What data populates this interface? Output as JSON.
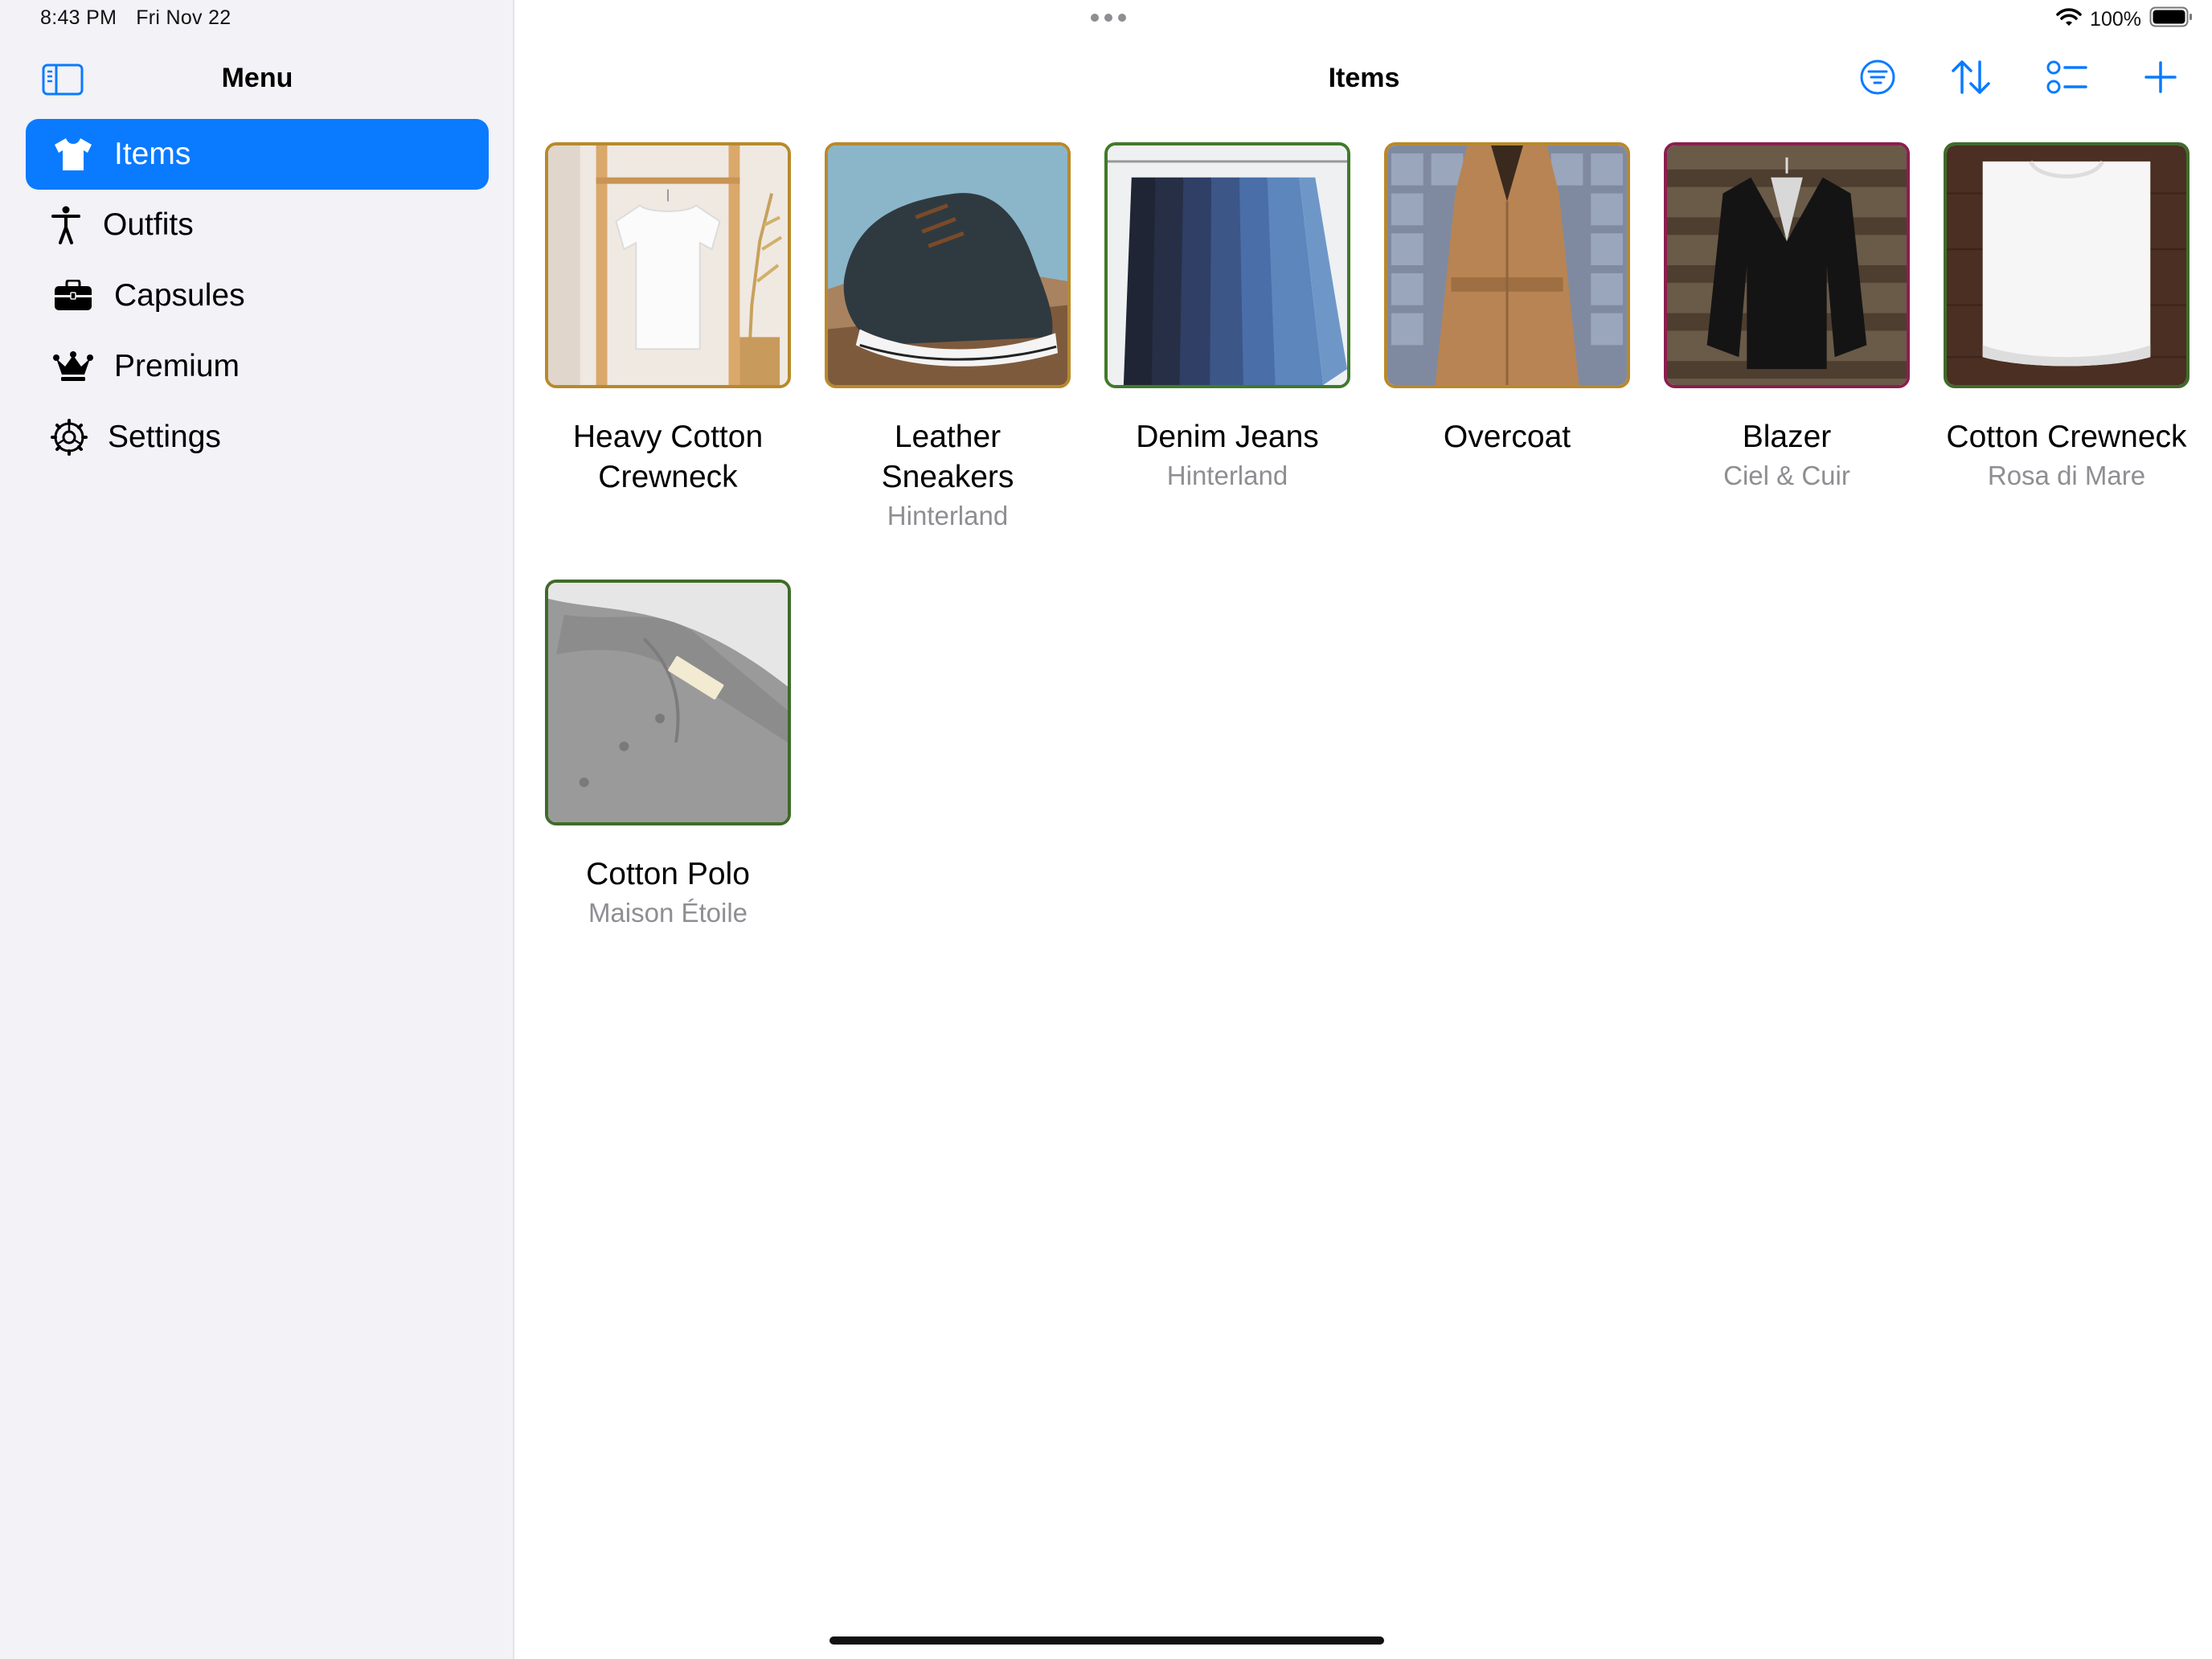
{
  "status": {
    "time": "8:43 PM",
    "date": "Fri Nov 22",
    "battery": "100%"
  },
  "sidebar": {
    "title": "Menu",
    "items": [
      {
        "label": "Items",
        "icon": "tshirt-icon",
        "selected": true
      },
      {
        "label": "Outfits",
        "icon": "figure-icon",
        "selected": false
      },
      {
        "label": "Capsules",
        "icon": "suitcase-icon",
        "selected": false
      },
      {
        "label": "Premium",
        "icon": "crown-icon",
        "selected": false
      },
      {
        "label": "Settings",
        "icon": "gear-icon",
        "selected": false
      }
    ]
  },
  "main": {
    "title": "Items",
    "toolbar": [
      "filter-icon",
      "sort-icon",
      "list-options-icon",
      "plus-icon"
    ],
    "items": [
      {
        "name": "Heavy Cotton Crewneck",
        "brand": "",
        "border": "#b8892b"
      },
      {
        "name": "Leather Sneakers",
        "brand": "Hinterland",
        "border": "#b8892b"
      },
      {
        "name": "Denim Jeans",
        "brand": "Hinterland",
        "border": "#3f7a2a"
      },
      {
        "name": "Overcoat",
        "brand": "",
        "border": "#b8892b"
      },
      {
        "name": "Blazer",
        "brand": "Ciel & Cuir",
        "border": "#8a1f4f"
      },
      {
        "name": "Cotton Crewneck",
        "brand": "Rosa di Mare",
        "border": "#3f6b2a"
      },
      {
        "name": "Cotton Polo",
        "brand": "Maison Étoile",
        "border": "#3f6b2a"
      }
    ]
  },
  "colors": {
    "accent": "#0a7aff",
    "sidebar_bg": "#f2f2f7",
    "secondary_text": "#8e8e93"
  }
}
